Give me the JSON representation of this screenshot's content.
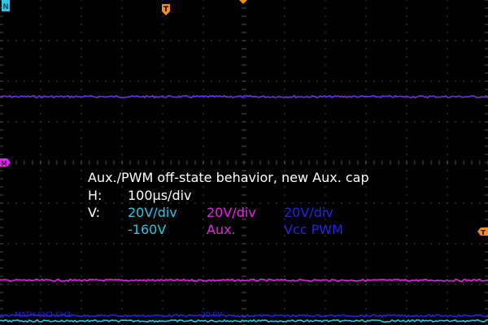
{
  "screen": {
    "background": "#000000",
    "grid_color": "#4a4a4a"
  },
  "markers": {
    "trigger_time": "T",
    "math": "M",
    "trigger_level": "T",
    "channel": "N"
  },
  "annotation": {
    "title": "Aux./PWM off-state behavior, new Aux. cap",
    "h_label": "H:",
    "h_value": "100µs/div",
    "v_label": "V:",
    "channels": [
      {
        "scale": "20V/div",
        "sub": "-160V",
        "color": "#29c6e6"
      },
      {
        "scale": "20V/div",
        "sub": "Aux.",
        "color": "#e524e5"
      },
      {
        "scale": "20V/div",
        "sub": "Vcc PWM",
        "color": "#2424e8"
      }
    ]
  },
  "footer": {
    "math": "MATH  CH2-CH3",
    "math_scale": "20.0V"
  },
  "chart_data": {
    "type": "line",
    "title": "Aux./PWM off-state behavior, new Aux. cap",
    "x_unit": "div",
    "xlim": [
      0,
      12
    ],
    "ylim": [
      -4,
      4
    ],
    "grid": true,
    "series": [
      {
        "name": "Vcc PWM",
        "color": "#7a2cf0",
        "level": 1.62
      },
      {
        "name": "Aux.",
        "color": "#e524e5",
        "level": -2.9
      },
      {
        "name": "Vcc PWM",
        "color": "#2424e8",
        "level": -3.77
      },
      {
        "name": "-160V",
        "color": "#29c6e6",
        "level": -3.9
      }
    ]
  }
}
